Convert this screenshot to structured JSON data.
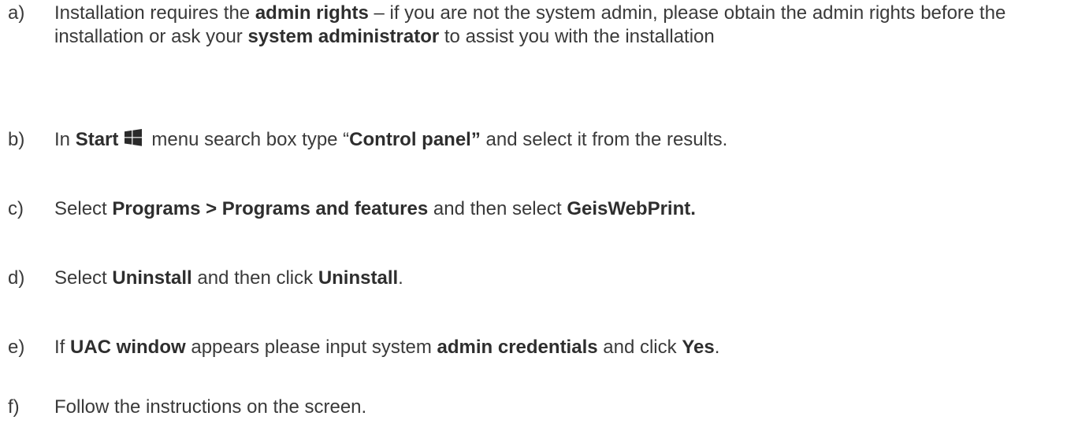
{
  "steps": [
    {
      "letter": "a)",
      "segments": [
        {
          "text": "Installation requires the ",
          "bold": false
        },
        {
          "text": "admin rights",
          "bold": true
        },
        {
          "text": " – if you are not the system admin, please obtain the admin rights before the installation or ask your ",
          "bold": false
        },
        {
          "text": "system administrator",
          "bold": true
        },
        {
          "text": " to assist you with the installation",
          "bold": false
        }
      ]
    },
    {
      "letter": "b)",
      "segments": [
        {
          "text": "In ",
          "bold": false
        },
        {
          "text": "Start",
          "bold": true
        },
        {
          "icon": "windows-logo-icon"
        },
        {
          "text": "menu search box type “",
          "bold": false
        },
        {
          "text": "Control panel”",
          "bold": true
        },
        {
          "text": " and select it from the results.",
          "bold": false
        }
      ]
    },
    {
      "letter": "c)",
      "segments": [
        {
          "text": "Select ",
          "bold": false
        },
        {
          "text": "Programs > Programs and features",
          "bold": true
        },
        {
          "text": " and then select ",
          "bold": false
        },
        {
          "text": "GeisWebPrint.",
          "bold": true
        }
      ]
    },
    {
      "letter": "d)",
      "segments": [
        {
          "text": "Select ",
          "bold": false
        },
        {
          "text": "Uninstall",
          "bold": true
        },
        {
          "text": " and then click ",
          "bold": false
        },
        {
          "text": "Uninstall",
          "bold": true
        },
        {
          "text": ".",
          "bold": false
        }
      ]
    },
    {
      "letter": "e)",
      "segments": [
        {
          "text": "If ",
          "bold": false
        },
        {
          "text": "UAC window",
          "bold": true
        },
        {
          "text": " appears please input system ",
          "bold": false
        },
        {
          "text": "admin credentials",
          "bold": true
        },
        {
          "text": " and click ",
          "bold": false
        },
        {
          "text": "Yes",
          "bold": true
        },
        {
          "text": ".",
          "bold": false
        }
      ]
    },
    {
      "letter": "f)",
      "segments": [
        {
          "text": "Follow the instructions on the screen.",
          "bold": false
        }
      ]
    }
  ]
}
